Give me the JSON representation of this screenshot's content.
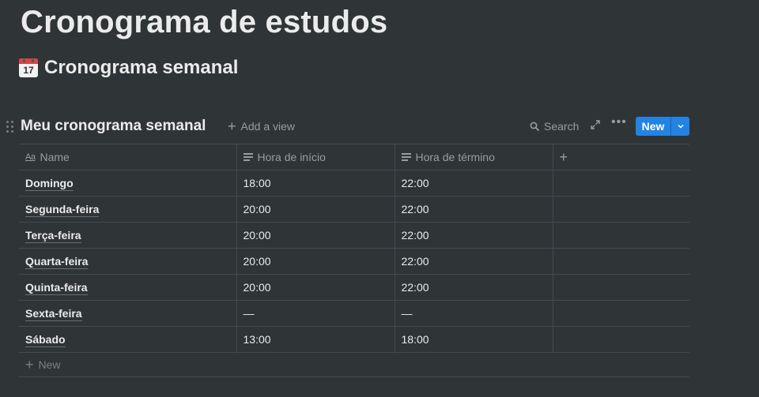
{
  "page": {
    "title": "Cronograma de estudos"
  },
  "section": {
    "icon": "calendar-icon",
    "icon_day": "17",
    "heading": "Cronograma semanal"
  },
  "database": {
    "title": "Meu cronograma semanal",
    "add_view_label": "Add a view",
    "search_label": "Search",
    "new_button_label": "New",
    "new_row_label": "New",
    "accent_color": "#2383e2",
    "columns": [
      {
        "label": "Name",
        "icon": "title-property-icon"
      },
      {
        "label": "Hora de início",
        "icon": "text-property-icon"
      },
      {
        "label": "Hora de término",
        "icon": "text-property-icon"
      }
    ],
    "rows": [
      {
        "name": "Domingo",
        "inicio": "18:00",
        "termino": "22:00"
      },
      {
        "name": "Segunda-feira",
        "inicio": "20:00",
        "termino": "22:00"
      },
      {
        "name": "Terça-feira",
        "inicio": "20:00",
        "termino": "22:00"
      },
      {
        "name": "Quarta-feira",
        "inicio": "20:00",
        "termino": "22:00"
      },
      {
        "name": "Quinta-feira",
        "inicio": "20:00",
        "termino": "22:00"
      },
      {
        "name": "Sexta-feira",
        "inicio": "—",
        "termino": "—"
      },
      {
        "name": "Sábado",
        "inicio": "13:00",
        "termino": "18:00"
      }
    ]
  }
}
